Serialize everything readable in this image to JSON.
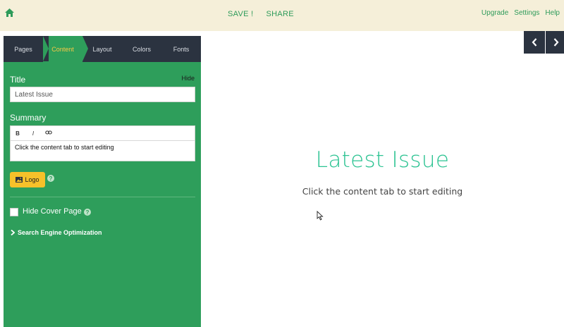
{
  "topbar": {
    "home_icon": "home-icon",
    "save_label": "SAVE !",
    "share_label": "SHARE",
    "links": [
      "Upgrade",
      "Settings",
      "Help"
    ]
  },
  "sidebar": {
    "tabs": [
      {
        "label": "Pages",
        "active": false
      },
      {
        "label": "Content",
        "active": true
      },
      {
        "label": "Layout",
        "active": false
      },
      {
        "label": "Colors",
        "active": false
      },
      {
        "label": "Fonts",
        "active": false
      }
    ],
    "title_label": "Title",
    "hide_label": "Hide",
    "title_value": "Latest Issue",
    "summary_label": "Summary",
    "editor_buttons": [
      "B",
      "I"
    ],
    "editor_link_icon": "link-icon",
    "summary_value": "Click the content tab to start editing",
    "logo_button_label": "Logo",
    "hide_cover_label": "Hide Cover Page",
    "hide_cover_checked": false,
    "seo_label": "Search Engine Optimization"
  },
  "preview": {
    "title": "Latest Issue",
    "subtitle": "Click the content tab to start editing"
  },
  "colors": {
    "accent_green": "#2e9e5b",
    "dark": "#2b3340",
    "tab_active_text": "#f6c945",
    "logo_button": "#f6c12a",
    "preview_title": "#2cc392"
  }
}
